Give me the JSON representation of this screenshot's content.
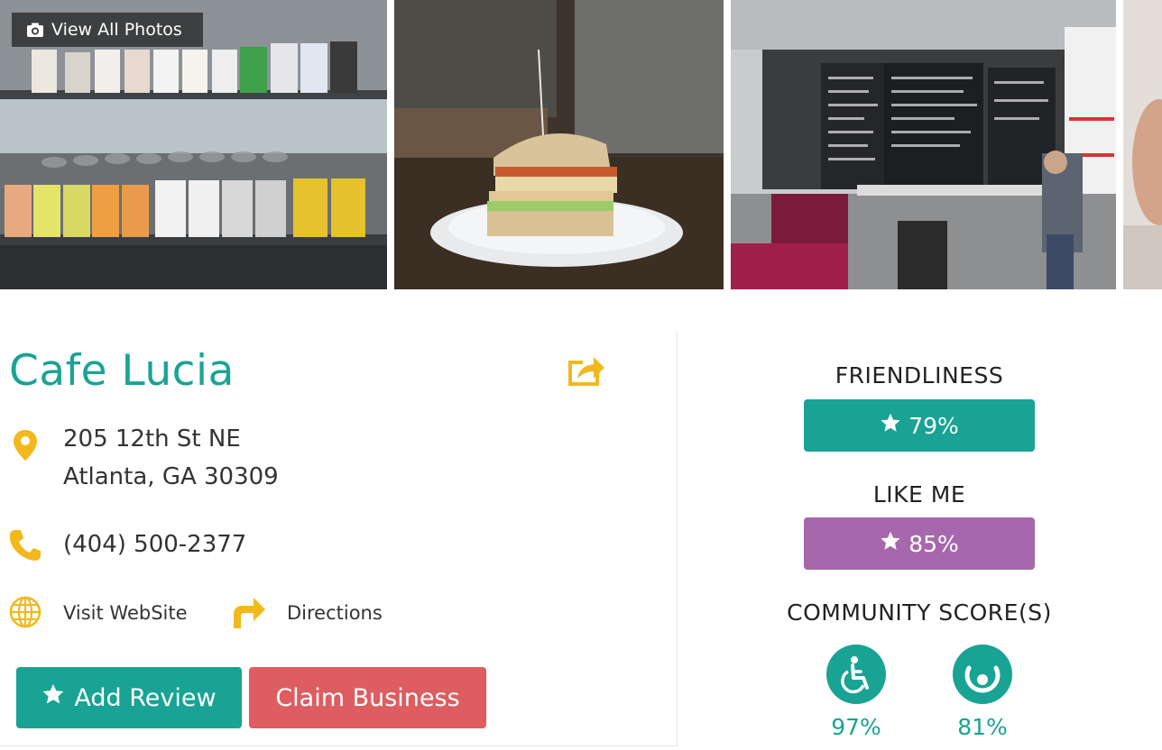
{
  "gallery": {
    "view_all_label": "View All Photos"
  },
  "business": {
    "name": "Cafe Lucia",
    "address_line1": "205 12th St NE",
    "address_line2": "Atlanta, GA 30309",
    "phone": "(404) 500-2377",
    "website_label": "Visit WebSite",
    "directions_label": "Directions"
  },
  "actions": {
    "add_review_label": "Add Review",
    "claim_business_label": "Claim Business"
  },
  "scores": {
    "friendliness_label": "FRIENDLINESS",
    "friendliness_value": "79%",
    "like_me_label": "LIKE ME",
    "like_me_value": "85%",
    "community_label": "COMMUNITY SCORE(S)",
    "accessibility_value": "97%",
    "second_value": "81%"
  },
  "colors": {
    "teal": "#18a394",
    "purple": "#a767ad",
    "red": "#dd5d61",
    "yellow": "#f2b81c"
  },
  "icons": [
    "camera-icon",
    "share-icon",
    "map-pin-icon",
    "phone-icon",
    "globe-icon",
    "directions-arrow-icon",
    "star-icon",
    "wheelchair-icon",
    "circle-score-icon"
  ]
}
